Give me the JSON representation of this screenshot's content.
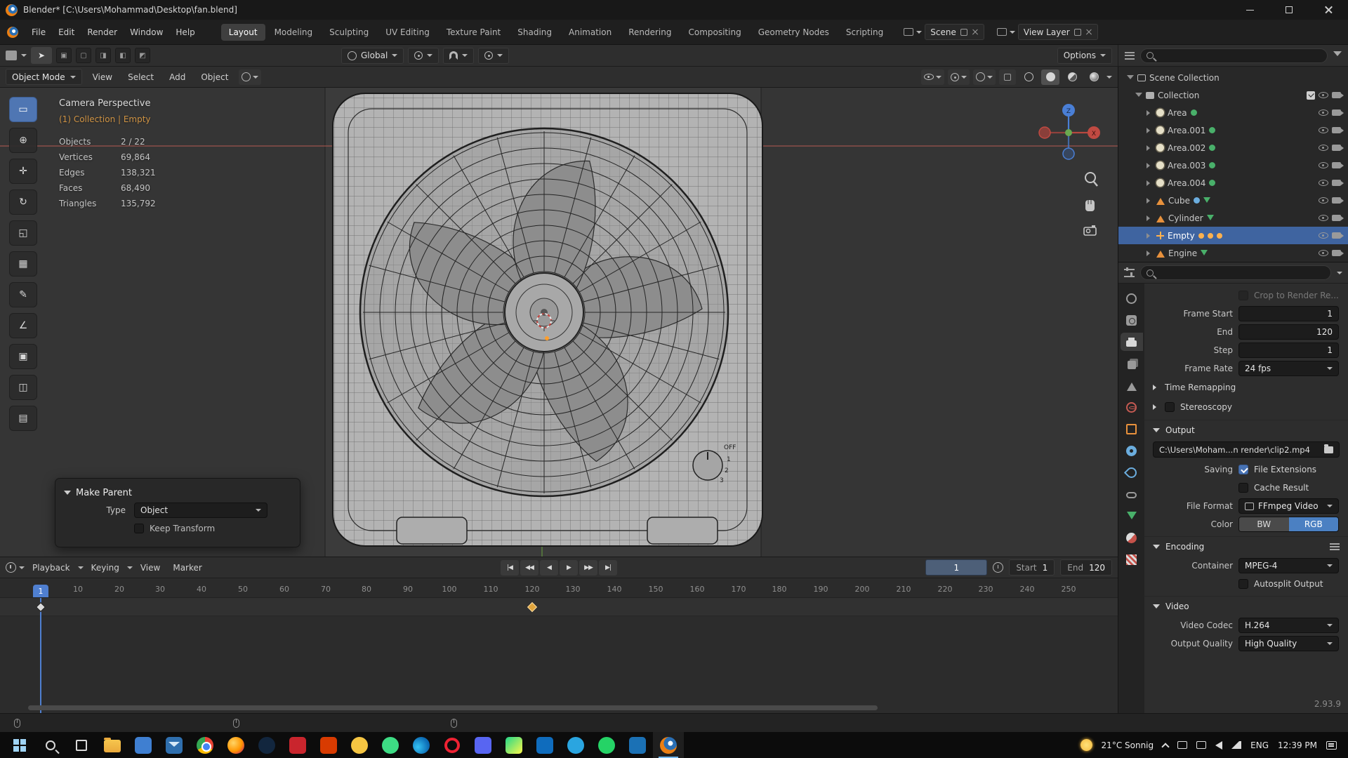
{
  "window": {
    "title": "Blender* [C:\\Users\\Mohammad\\Desktop\\fan.blend]"
  },
  "topbar": {
    "menus": [
      "File",
      "Edit",
      "Render",
      "Window",
      "Help"
    ],
    "workspaces": [
      "Layout",
      "Modeling",
      "Sculpting",
      "UV Editing",
      "Texture Paint",
      "Shading",
      "Animation",
      "Rendering",
      "Compositing",
      "Geometry Nodes",
      "Scripting"
    ],
    "scene": "Scene",
    "view_layer": "View Layer"
  },
  "tools": {
    "orientation": "Global",
    "options": "Options"
  },
  "viewport": {
    "mode": "Object Mode",
    "menus": [
      "View",
      "Select",
      "Add",
      "Object"
    ],
    "tool_glyphs": [
      "▭",
      "⊕",
      "✛",
      "↻",
      "◱",
      "▦",
      "✎",
      "∠",
      "▣",
      "◫",
      "▤"
    ],
    "overlay": {
      "title": "Camera Perspective",
      "context": "(1) Collection | Empty",
      "stats": [
        {
          "l": "Objects",
          "v": "2 / 22"
        },
        {
          "l": "Vertices",
          "v": "69,864"
        },
        {
          "l": "Edges",
          "v": "138,321"
        },
        {
          "l": "Faces",
          "v": "68,490"
        },
        {
          "l": "Triangles",
          "v": "135,792"
        }
      ]
    },
    "gizmo": {
      "z": "Z",
      "x": "X"
    },
    "knob": {
      "off": "OFF",
      "s1": "1",
      "s2": "2",
      "s3": "3"
    },
    "make_parent": {
      "title": "Make Parent",
      "type_label": "Type",
      "type_value": "Object",
      "keep": "Keep Transform"
    }
  },
  "timeline": {
    "menus": [
      "Playback",
      "Keying",
      "View",
      "Marker"
    ],
    "transport": [
      "|◀",
      "◀◀",
      "◀",
      "▶",
      "▶▶",
      "▶|"
    ],
    "frame": "1",
    "start_label": "Start",
    "start": "1",
    "end_label": "End",
    "end": "120",
    "ticks": [
      "1",
      "10",
      "20",
      "30",
      "40",
      "50",
      "60",
      "70",
      "80",
      "90",
      "100",
      "110",
      "120",
      "130",
      "140",
      "150",
      "160",
      "170",
      "180",
      "190",
      "200",
      "210",
      "220",
      "230",
      "240",
      "250"
    ]
  },
  "outliner": {
    "scene_collection": "Scene Collection",
    "collection": "Collection",
    "items": [
      {
        "name": "Area"
      },
      {
        "name": "Area.001"
      },
      {
        "name": "Area.002"
      },
      {
        "name": "Area.003"
      },
      {
        "name": "Area.004"
      },
      {
        "name": "Cube"
      },
      {
        "name": "Cylinder"
      },
      {
        "name": "Empty"
      },
      {
        "name": "Engine"
      }
    ]
  },
  "properties": {
    "crop": "Crop to Render Re...",
    "frame_start_label": "Frame Start",
    "frame_start": "1",
    "end_label": "End",
    "end": "120",
    "step_label": "Step",
    "step": "1",
    "frame_rate_label": "Frame Rate",
    "frame_rate": "24 fps",
    "time_remapping": "Time Remapping",
    "stereoscopy": "Stereoscopy",
    "output": "Output",
    "output_path": "C:\\Users\\Moham...n render\\clip2.mp4",
    "saving_label": "Saving",
    "file_extensions": "File Extensions",
    "cache_result": "Cache Result",
    "file_format_label": "File Format",
    "file_format": "FFmpeg Video",
    "color_label": "Color",
    "bw": "BW",
    "rgb": "RGB",
    "encoding": "Encoding",
    "container_label": "Container",
    "container": "MPEG-4",
    "autosplit": "Autosplit Output",
    "video": "Video",
    "video_codec_label": "Video Codec",
    "video_codec": "H.264",
    "output_quality_label": "Output Quality",
    "output_quality": "High Quality"
  },
  "taskbar": {
    "weather": "21°C Sonnig",
    "lang": "ENG",
    "time": "12:39 PM"
  },
  "version": "2.93.9"
}
